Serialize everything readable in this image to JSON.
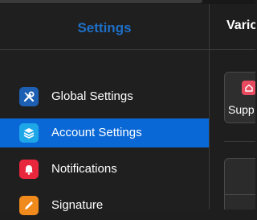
{
  "sidebar": {
    "title": "Settings",
    "items": [
      {
        "label": "Global Settings",
        "icon": "wrench-screwdriver-icon",
        "color": "#1d5fb3",
        "active": false
      },
      {
        "label": "Account Settings",
        "icon": "layers-icon",
        "color": "#1ea7e8",
        "active": true
      },
      {
        "label": "Notifications",
        "icon": "bell-icon",
        "color": "#e8263c",
        "active": false
      },
      {
        "label": "Signature",
        "icon": "pen-icon",
        "color": "#f08a1c",
        "active": false
      }
    ]
  },
  "main": {
    "title": "Vario",
    "card_label": "Supp",
    "card_icon": "home-icon",
    "card_icon_color": "#e84b5f"
  },
  "colors": {
    "accent": "#0a68d6",
    "title": "#1e6fc8",
    "background": "#1f1f1f"
  }
}
